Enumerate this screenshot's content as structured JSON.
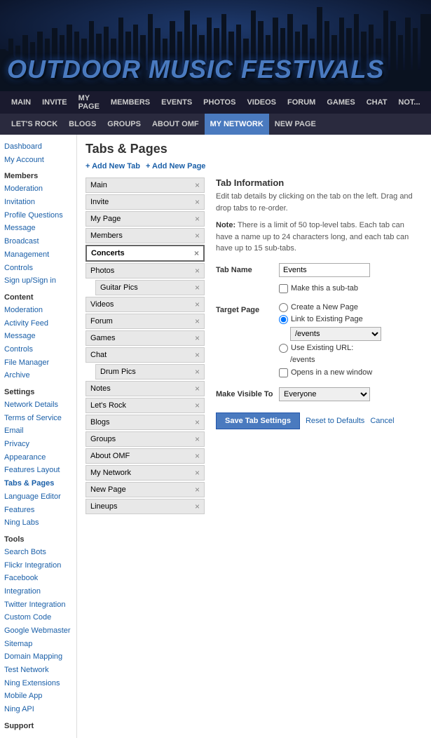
{
  "header": {
    "title": "OUTDOOR MUSIC FESTIVALS"
  },
  "top_nav": {
    "items": [
      {
        "label": "MAIN",
        "active": false
      },
      {
        "label": "INVITE",
        "active": false
      },
      {
        "label": "MY PAGE",
        "active": false
      },
      {
        "label": "MEMBERS",
        "active": false
      },
      {
        "label": "EVENTS",
        "active": false
      },
      {
        "label": "PHOTOS",
        "active": false
      },
      {
        "label": "VIDEOS",
        "active": false
      },
      {
        "label": "FORUM",
        "active": false
      },
      {
        "label": "GAMES",
        "active": false
      },
      {
        "label": "CHAT",
        "active": false
      },
      {
        "label": "NOT...",
        "active": false
      }
    ]
  },
  "second_nav": {
    "items": [
      {
        "label": "LET'S ROCK",
        "active": false
      },
      {
        "label": "BLOGS",
        "active": false
      },
      {
        "label": "GROUPS",
        "active": false
      },
      {
        "label": "ABOUT OMF",
        "active": false
      },
      {
        "label": "MY NETWORK",
        "active": true
      },
      {
        "label": "NEW PAGE",
        "active": false
      }
    ]
  },
  "sidebar": {
    "dashboard_label": "Dashboard",
    "my_account_label": "My Account",
    "sections": [
      {
        "title": "Members",
        "links": [
          "Moderation",
          "Invitation",
          "Profile Questions",
          "Message Broadcast",
          "Management",
          "Controls",
          "Sign up/Sign in"
        ]
      },
      {
        "title": "Content",
        "links": [
          "Moderation",
          "Activity Feed Message",
          "Controls",
          "File Manager",
          "Archive"
        ]
      },
      {
        "title": "Settings",
        "links": [
          "Network Details",
          "Terms of Service",
          "Email",
          "Privacy",
          "Appearance",
          "Features Layout",
          "Tabs & Pages",
          "Language Editor",
          "Features",
          "Ning Labs"
        ]
      },
      {
        "title": "Tools",
        "links": [
          "Search Bots",
          "Flickr Integration",
          "Facebook Integration",
          "Twitter Integration",
          "Custom Code",
          "Google Webmaster",
          "Sitemap",
          "Domain Mapping",
          "Test Network",
          "Ning Extensions",
          "Mobile App",
          "Ning API"
        ]
      },
      {
        "title": "Support",
        "links": []
      }
    ]
  },
  "content": {
    "page_title": "Tabs & Pages",
    "add_tab_label": "Add New Tab",
    "add_page_label": "Add New Page",
    "tabs": [
      {
        "label": "Main",
        "active": false,
        "sub": false
      },
      {
        "label": "Invite",
        "active": false,
        "sub": false
      },
      {
        "label": "My Page",
        "active": false,
        "sub": false
      },
      {
        "label": "Members",
        "active": false,
        "sub": false
      },
      {
        "label": "Concerts",
        "active": true,
        "sub": false
      },
      {
        "label": "Photos",
        "active": false,
        "sub": false
      },
      {
        "label": "Guitar Pics",
        "active": false,
        "sub": true
      },
      {
        "label": "Videos",
        "active": false,
        "sub": false
      },
      {
        "label": "Forum",
        "active": false,
        "sub": false
      },
      {
        "label": "Games",
        "active": false,
        "sub": false
      },
      {
        "label": "Chat",
        "active": false,
        "sub": false
      },
      {
        "label": "Drum Pics",
        "active": false,
        "sub": true
      },
      {
        "label": "Notes",
        "active": false,
        "sub": false
      },
      {
        "label": "Let's Rock",
        "active": false,
        "sub": false
      },
      {
        "label": "Blogs",
        "active": false,
        "sub": false
      },
      {
        "label": "Groups",
        "active": false,
        "sub": false
      },
      {
        "label": "About OMF",
        "active": false,
        "sub": false
      },
      {
        "label": "My Network",
        "active": false,
        "sub": false
      },
      {
        "label": "New Page",
        "active": false,
        "sub": false
      },
      {
        "label": "Lineups",
        "active": false,
        "sub": false
      }
    ],
    "tab_info": {
      "title": "Tab Information",
      "description": "Edit tab details by clicking on the tab on the left. Drag and drop tabs to re-order.",
      "note": "There is a limit of 50 top-level tabs. Each tab can have a name up to 24 characters long, and each tab can have up to 15 sub-tabs.",
      "tab_name_label": "Tab Name",
      "tab_name_value": "Events",
      "make_sub_tab_label": "Make this a sub-tab",
      "target_page_label": "Target Page",
      "target_page_options": [
        {
          "label": "Create a New Page",
          "value": "create_new"
        },
        {
          "label": "Link to Existing Page",
          "value": "link_existing",
          "selected": true
        },
        {
          "label": "Use Existing URL:",
          "value": "use_url"
        }
      ],
      "existing_page_dropdown_value": "/events",
      "existing_page_dropdown_options": [
        "/events"
      ],
      "use_url_value": "/events",
      "opens_new_window_label": "Opens in a new window",
      "make_visible_label": "Make Visible To",
      "make_visible_value": "Everyone",
      "make_visible_options": [
        "Everyone"
      ],
      "save_btn_label": "Save Tab Settings",
      "reset_label": "Reset to Defaults",
      "cancel_label": "Cancel"
    }
  }
}
